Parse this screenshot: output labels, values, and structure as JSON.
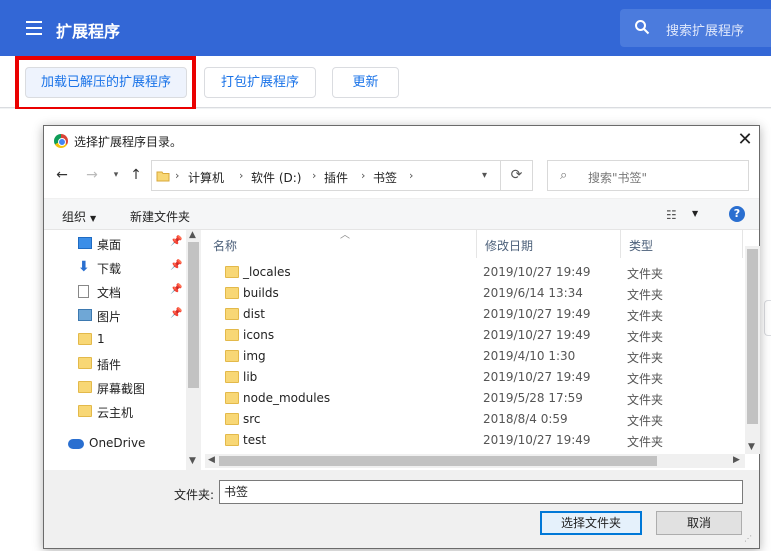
{
  "header": {
    "title": "扩展程序",
    "search_placeholder": "搜索扩展程序",
    "accent": "#3367d6"
  },
  "toolbar": {
    "load_unpacked": "加载已解压的扩展程序",
    "pack": "打包扩展程序",
    "update": "更新"
  },
  "dialog": {
    "title": "选择扩展程序目录。",
    "close": "✕",
    "breadcrumb": [
      "计算机",
      "软件 (D:)",
      "插件",
      "书签"
    ],
    "search_placeholder": "搜索\"书签\"",
    "organize": "组织",
    "new_folder": "新建文件夹",
    "help": "?",
    "nav_items": [
      {
        "label": "桌面",
        "icon": "desktop-icon",
        "pinned": true
      },
      {
        "label": "下载",
        "icon": "download-icon",
        "pinned": true
      },
      {
        "label": "文档",
        "icon": "document-icon",
        "pinned": true
      },
      {
        "label": "图片",
        "icon": "pictures-icon",
        "pinned": true
      },
      {
        "label": "1",
        "icon": "folder-icon",
        "pinned": false
      },
      {
        "label": "插件",
        "icon": "folder-icon",
        "pinned": false
      },
      {
        "label": "屏幕截图",
        "icon": "folder-icon",
        "pinned": false
      },
      {
        "label": "云主机",
        "icon": "folder-icon",
        "pinned": false
      },
      {
        "label": "OneDrive",
        "icon": "cloud-icon",
        "pinned": false
      }
    ],
    "columns": {
      "name": "名称",
      "date": "修改日期",
      "type": "类型"
    },
    "files": [
      {
        "name": "_locales",
        "date": "2019/10/27 19:49",
        "type": "文件夹"
      },
      {
        "name": "builds",
        "date": "2019/6/14 13:34",
        "type": "文件夹"
      },
      {
        "name": "dist",
        "date": "2019/10/27 19:49",
        "type": "文件夹"
      },
      {
        "name": "icons",
        "date": "2019/10/27 19:49",
        "type": "文件夹"
      },
      {
        "name": "img",
        "date": "2019/4/10 1:30",
        "type": "文件夹"
      },
      {
        "name": "lib",
        "date": "2019/10/27 19:49",
        "type": "文件夹"
      },
      {
        "name": "node_modules",
        "date": "2019/5/28 17:59",
        "type": "文件夹"
      },
      {
        "name": "src",
        "date": "2018/8/4 0:59",
        "type": "文件夹"
      },
      {
        "name": "test",
        "date": "2019/10/27 19:49",
        "type": "文件夹"
      }
    ],
    "filename_label": "文件夹:",
    "filename_value": "书签",
    "select_button": "选择文件夹",
    "cancel_button": "取消"
  }
}
